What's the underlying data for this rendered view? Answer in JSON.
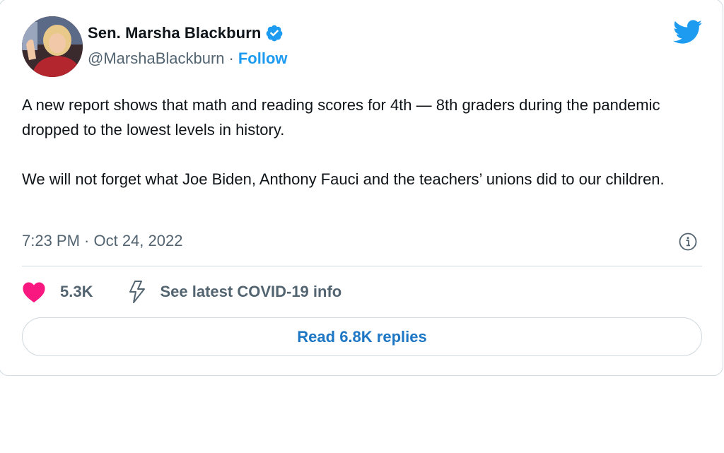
{
  "author": {
    "name": "Sen. Marsha Blackburn",
    "handle": "@MarshaBlackburn",
    "separator": "·",
    "follow_label": "Follow"
  },
  "tweet": {
    "paragraphs": [
      "A new report shows that math and reading scores for 4th — 8th graders during the pandemic dropped to the lowest levels in history.",
      "We will not forget what Joe Biden, Anthony Fauci and the teachers’ unions did to our children."
    ],
    "timestamp": "7:23 PM · Oct 24, 2022"
  },
  "actions": {
    "like_count": "5.3K",
    "covid_info_label": "See latest COVID-19 info",
    "replies_label": "Read 6.8K replies"
  },
  "icons": {
    "brand": "twitter-bird-icon",
    "verified": "verified-badge-icon",
    "info": "info-icon",
    "like": "heart-icon",
    "covid": "lightning-bolt-icon"
  },
  "colors": {
    "brand_blue": "#1d9bf0",
    "link_blue": "#1d77c4",
    "like_pink": "#f91880",
    "secondary_text": "#536471",
    "border": "#cfd9de"
  }
}
